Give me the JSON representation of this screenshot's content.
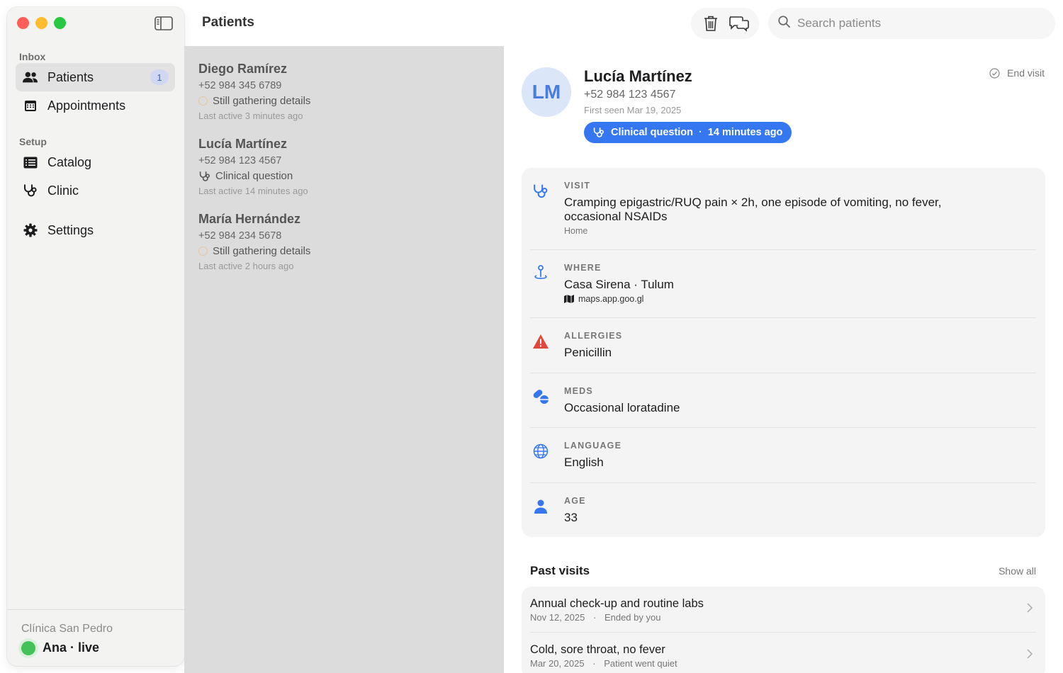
{
  "sidebar": {
    "inbox_label": "Inbox",
    "setup_label": "Setup",
    "items": [
      {
        "label": "Patients",
        "icon": "people-icon",
        "badge": "1",
        "active": true
      },
      {
        "label": "Appointments",
        "icon": "calendar-icon"
      },
      {
        "label": "Catalog",
        "icon": "list-icon"
      },
      {
        "label": "Clinic",
        "icon": "stethoscope-icon"
      },
      {
        "label": "Settings",
        "icon": "gear-icon"
      }
    ],
    "footer": {
      "clinic": "Clínica San Pedro",
      "user": "Ana · live"
    }
  },
  "header": {
    "title": "Patients",
    "search_placeholder": "Search patients"
  },
  "patients": [
    {
      "name": "Diego Ramírez",
      "phone": "+52 984 345 6789",
      "status": "Still gathering details",
      "status_icon": "ring-icon",
      "last_active": "Last active 3 minutes ago"
    },
    {
      "name": "Lucía Martínez",
      "phone": "+52 984 123 4567",
      "status": "Clinical question",
      "status_icon": "stethoscope-icon",
      "last_active": "Last active 14 minutes ago"
    },
    {
      "name": "María Hernández",
      "phone": "+52 984 234 5678",
      "status": "Still gathering details",
      "status_icon": "ring-icon",
      "last_active": "Last active 2 hours ago"
    }
  ],
  "detail": {
    "initials": "LM",
    "name": "Lucía Martínez",
    "phone": "+52 984 123 4567",
    "first_seen": "First seen Mar 19, 2025",
    "pill_label": "Clinical question",
    "pill_sep": "·",
    "pill_time": "14 minutes ago",
    "end_visit": "End visit",
    "rows": [
      {
        "label": "VISIT",
        "value": "Cramping epigastric/RUQ pain × 2h, one episode of vomiting, no fever, occasional NSAIDs",
        "sub": "Home"
      },
      {
        "label": "WHERE",
        "value": "Casa Sirena · Tulum",
        "sub": "maps.app.goo.gl"
      },
      {
        "label": "ALLERGIES",
        "value": "Penicillin"
      },
      {
        "label": "MEDS",
        "value": "Occasional loratadine"
      },
      {
        "label": "LANGUAGE",
        "value": "English"
      },
      {
        "label": "AGE",
        "value": "33"
      }
    ],
    "past_visits_title": "Past visits",
    "show_all": "Show all",
    "past_visits": [
      {
        "title": "Annual check-up and routine labs",
        "date": "Nov 12, 2025",
        "sep": "·",
        "outcome": "Ended by you"
      },
      {
        "title": "Cold, sore throat, no fever",
        "date": "Mar 20, 2025",
        "sep": "·",
        "outcome": "Patient went quiet"
      }
    ]
  },
  "colors": {
    "accent": "#3577f0",
    "danger": "#e0483d",
    "online": "#45c15a"
  }
}
